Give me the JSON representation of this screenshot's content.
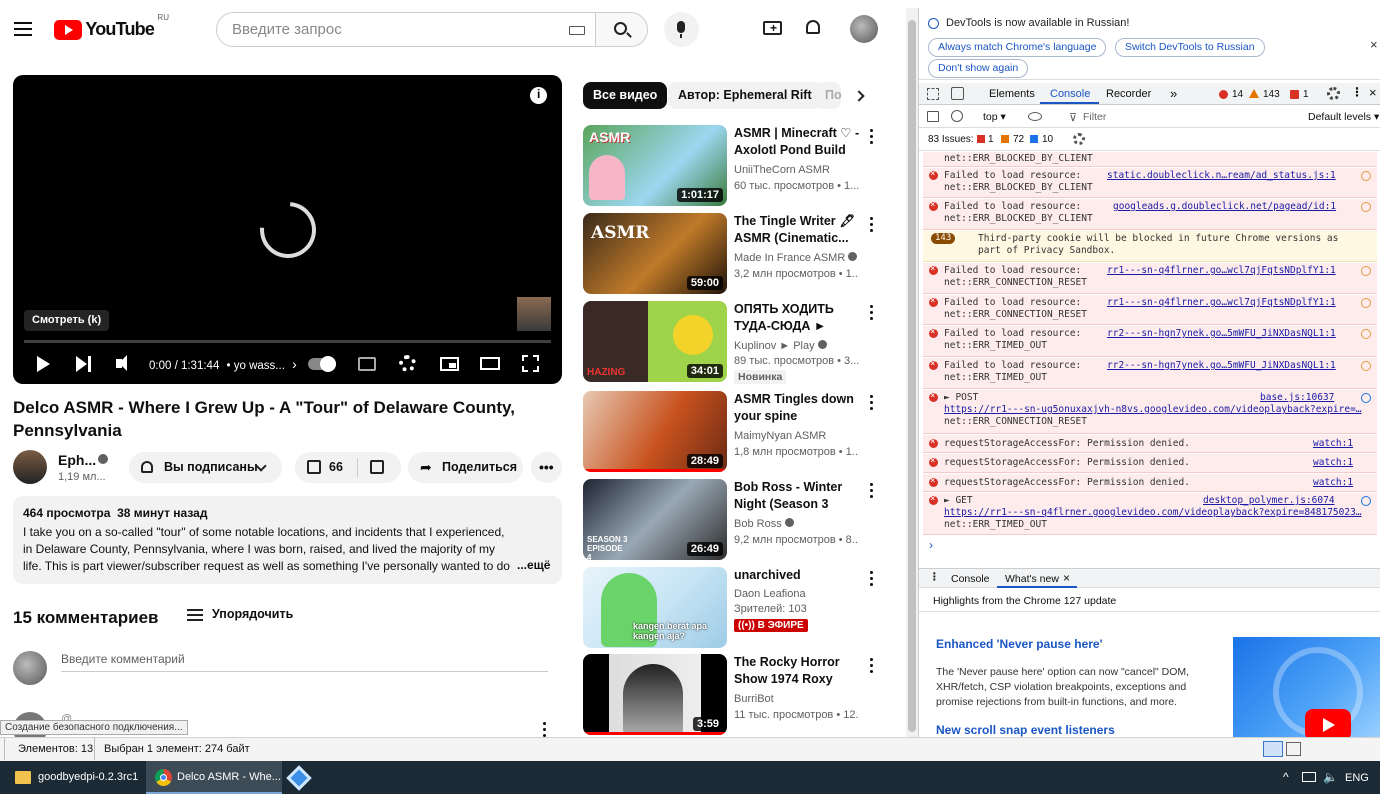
{
  "youtube": {
    "logo_text": "YouTube",
    "logo_region": "RU",
    "search_placeholder": "Введите запрос",
    "player": {
      "watch_label": "Смотреть (k)",
      "time": "0:00 / 1:31:44",
      "chapter": "• yo wass...",
      "chapter_arrow": "›"
    },
    "video": {
      "title": "Delco ASMR - Where I Grew Up - A \"Tour\" of Delaware County, Pennsylvania",
      "channel_name": "Eph...",
      "subscribers": "1,19 мл...",
      "subscribe_label": "Вы подписаны",
      "likes": "66",
      "share_label": "Поделиться",
      "views": "464 просмотра",
      "ago": "38 минут назад",
      "description": "I take you on a so-called \"tour\" of some notable locations, and incidents that I experienced, in Delaware County, Pennsylvania, where I was born, raised, and lived the majority of my life. This is part viewer/subscriber request as well as something I've personally wanted to do since start",
      "more_label": "...ещё"
    },
    "comments": {
      "count_label": "15 комментариев",
      "sort_label": "Упорядочить",
      "input_placeholder": "Введите комментарий",
      "partial_author": "@...",
      "tooltip": "Создание безопасного подключения..."
    },
    "chips": [
      "Все видео",
      "Автор: Ephemeral Rift",
      "По..."
    ],
    "related": [
      {
        "title": "ASMR | Minecraft ♡ - Axolotl Pond Build 🌸...",
        "channel": "UniiTheCorn ASMR",
        "meta": "60 тыс. просмотров • 1...",
        "duration": "1:01:17",
        "thumb_text": "ASMR",
        "verified": false
      },
      {
        "title": "The Tingle Writer 🖋 ASMR (Cinematic...",
        "channel": "Made In France ASMR",
        "meta": "3,2 млн просмотров • 1...",
        "duration": "59:00",
        "thumb_text": "ASMR",
        "verified": true
      },
      {
        "title": "ОПЯТЬ ХОДИТЬ ТУДА-СЮДА ► Hazing -...",
        "channel": "Kuplinov ► Play",
        "meta": "89 тыс. просмотров • 3...",
        "duration": "34:01",
        "badge": "Новинка",
        "thumb_text": "HAZING",
        "verified": true
      },
      {
        "title": "ASMR Tingles down your spine",
        "channel": "MaimyNyan ASMR",
        "meta": "1,8 млн просмотров • 1...",
        "duration": "28:49",
        "verified": false
      },
      {
        "title": "Bob Ross - Winter Night (Season 3 Episode 4)",
        "channel": "Bob Ross",
        "meta": "9,2 млн просмотров • 8...",
        "duration": "26:49",
        "thumb_text": "SEASON 3 EPISODE 4",
        "verified": true
      },
      {
        "title": "unarchived",
        "channel": "Daon Leafiona",
        "meta": "Зрителей: 103",
        "live": "В ЭФИРЕ",
        "thumb_text": "kangen berat apa kangen aja?",
        "verified": false
      },
      {
        "title": "The Rocky Horror Show 1974 Roxy Cast- The...",
        "channel": "BurriBot",
        "meta": "11 тыс. просмотров • 12...",
        "duration": "3:59",
        "verified": false
      }
    ]
  },
  "devtools": {
    "banner": {
      "text": "DevTools is now available in Russian!",
      "btn1": "Always match Chrome's language",
      "btn2": "Switch DevTools to Russian",
      "btn3": "Don't show again"
    },
    "tabs": [
      "Elements",
      "Console",
      "Recorder",
      "»"
    ],
    "active_tab": "Console",
    "counts": {
      "errors": "14",
      "warnings": "143",
      "issues_err": "1"
    },
    "toolbar": {
      "context": "top ▾",
      "filter_placeholder": "Filter",
      "levels": "Default levels ▾"
    },
    "issues": {
      "label": "83 Issues:",
      "err": "1",
      "warn": "72",
      "info": "10"
    },
    "logs": [
      {
        "type": "error",
        "line1": "",
        "line2": "net::ERR_BLOCKED_BY_CLIENT",
        "link": ""
      },
      {
        "type": "error",
        "line1": "Failed to load resource:",
        "line2": "net::ERR_BLOCKED_BY_CLIENT",
        "link": "static.doubleclick.n…ream/ad_status.js:1"
      },
      {
        "type": "error",
        "line1": "Failed to load resource:",
        "line2": "net::ERR_BLOCKED_BY_CLIENT",
        "link": "googleads.g.doubleclick.net/pagead/id:1"
      },
      {
        "type": "warn",
        "badge": "143",
        "line1": "Third-party cookie will be blocked in future Chrome versions as",
        "line2": "part of Privacy Sandbox.",
        "link": ""
      },
      {
        "type": "error",
        "line1": "Failed to load resource:",
        "line2": "net::ERR_CONNECTION_RESET",
        "link": "rr1---sn-q4flrner.go…wcl7qjFqtsNDplfY1:1"
      },
      {
        "type": "error",
        "line1": "Failed to load resource:",
        "line2": "net::ERR_CONNECTION_RESET",
        "link": "rr1---sn-q4flrner.go…wcl7qjFqtsNDplfY1:1"
      },
      {
        "type": "error",
        "line1": "Failed to load resource:",
        "line2": "net::ERR_TIMED_OUT",
        "link": "rr2---sn-hgn7ynek.go…5mWFU_JiNXDasNQL1:1"
      },
      {
        "type": "error",
        "line1": "Failed to load resource:",
        "line2": "net::ERR_TIMED_OUT",
        "link": "rr2---sn-hgn7ynek.go…5mWFU_JiNXDasNQL1:1"
      }
    ],
    "post_log": {
      "method": "► POST",
      "link": "base.js:10637",
      "url": "https://rr1---sn-ug5onuxaxjvh-n8vs.googlevideo.com/videoplayback?expire=…",
      "error": "net::ERR_CONNECTION_RESET"
    },
    "storage_logs": [
      {
        "text": "requestStorageAccessFor: Permission denied.",
        "link": "watch:1"
      },
      {
        "text": "requestStorageAccessFor: Permission denied.",
        "link": "watch:1"
      },
      {
        "text": "requestStorageAccessFor: Permission denied.",
        "link": "watch:1"
      }
    ],
    "get_log": {
      "method": "► GET",
      "link": "desktop_polymer.js:6074",
      "url": "https://rr1---sn-q4flrner.googlevideo.com/videoplayback?expire=848175023…",
      "error": "net::ERR_TIMED_OUT"
    },
    "prompt": "›",
    "drawer": {
      "tabs": [
        "Console",
        "What's new"
      ],
      "highlight": "Highlights from the Chrome 127 update",
      "h1": "Enhanced 'Never pause here'",
      "p1": "The 'Never pause here' option can now \"cancel\" DOM, XHR/fetch, CSP violation breakpoints, exceptions and promise rejections from built-in functions, and more.",
      "h2": "New scroll snap event listeners"
    }
  },
  "statusbar": {
    "elements": "Элементов: 13",
    "selected": "Выбран 1 элемент: 274 байт"
  },
  "taskbar": {
    "items": [
      "goodbyedpi-0.2.3rc1",
      "Delco ASMR - Whe..."
    ],
    "lang": "ENG"
  }
}
